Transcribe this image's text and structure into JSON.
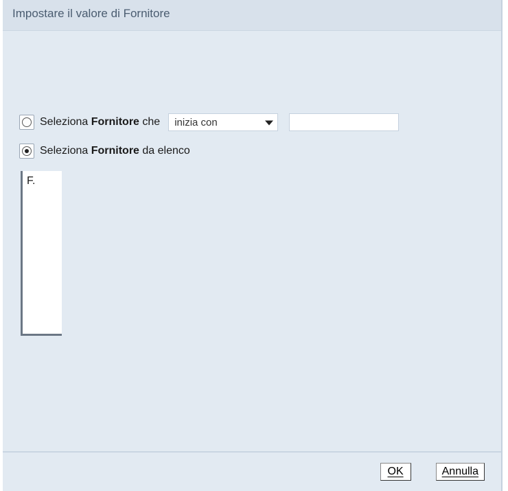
{
  "dialog": {
    "title": "Impostare il valore di Fornitore"
  },
  "options": {
    "byText": {
      "prefix": "Seleziona",
      "bold": "Fornitore",
      "suffix": "che",
      "dropdownValue": "inizia con",
      "inputValue": ""
    },
    "byList": {
      "prefix": "Seleziona",
      "bold": "Fornitore",
      "suffix": "da elenco"
    }
  },
  "selectedOption": "list",
  "listItems": {
    "0": "F."
  },
  "buttons": {
    "ok": "OK",
    "cancel": "Annulla"
  }
}
